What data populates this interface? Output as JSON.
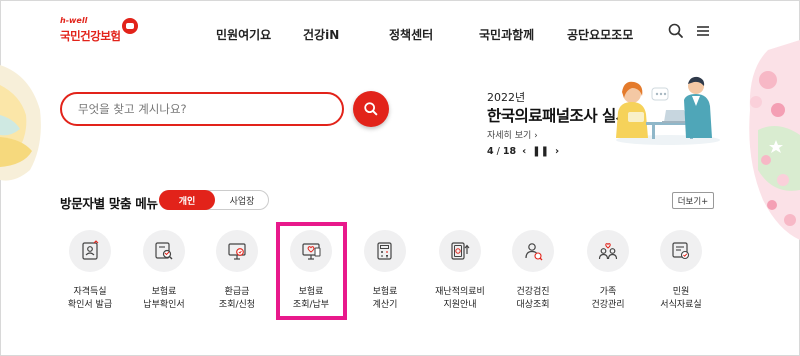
{
  "header": {
    "logo_small": "h-well",
    "logo_main": "국민건강보험",
    "nav": [
      "민원여기요",
      "건강iN",
      "정책센터",
      "국민과함께",
      "공단요모조모"
    ],
    "icons": [
      "search-icon",
      "hamburger-menu-icon"
    ]
  },
  "search": {
    "placeholder": "무엇을 찾고 계시나요?"
  },
  "banner": {
    "year": "2022년",
    "title": "한국의료패널조사 실시",
    "more": "자세히 보기",
    "page_current": "4",
    "page_sep": "/",
    "page_total": "18"
  },
  "custom_menu": {
    "title": "방문자별 맞춤 메뉴",
    "tabs": [
      "개인",
      "사업장"
    ],
    "active_tab": "개인",
    "more_button": "더보기+",
    "items": [
      {
        "line1": "자격득실",
        "line2": "확인서 발급",
        "icon": "certificate-icon"
      },
      {
        "line1": "보험료",
        "line2": "납부확인서",
        "icon": "document-search-icon"
      },
      {
        "line1": "환급금",
        "line2": "조회/신청",
        "icon": "refund-monitor-icon"
      },
      {
        "line1": "보험료",
        "line2": "조회/납부",
        "icon": "premium-payment-icon"
      },
      {
        "line1": "보험료",
        "line2": "계산기",
        "icon": "calculator-icon"
      },
      {
        "line1": "재난적의료비",
        "line2": "지원안내",
        "icon": "medical-support-icon"
      },
      {
        "line1": "건강검진",
        "line2": "대상조회",
        "icon": "health-checkup-icon"
      },
      {
        "line1": "가족",
        "line2": "건강관리",
        "icon": "family-icon"
      },
      {
        "line1": "민원",
        "line2": "서식자료실",
        "icon": "form-archive-icon"
      }
    ]
  },
  "colors": {
    "brand": "#e2231a",
    "highlight": "#e8198b",
    "icon_bg": "#f0f0f1"
  }
}
